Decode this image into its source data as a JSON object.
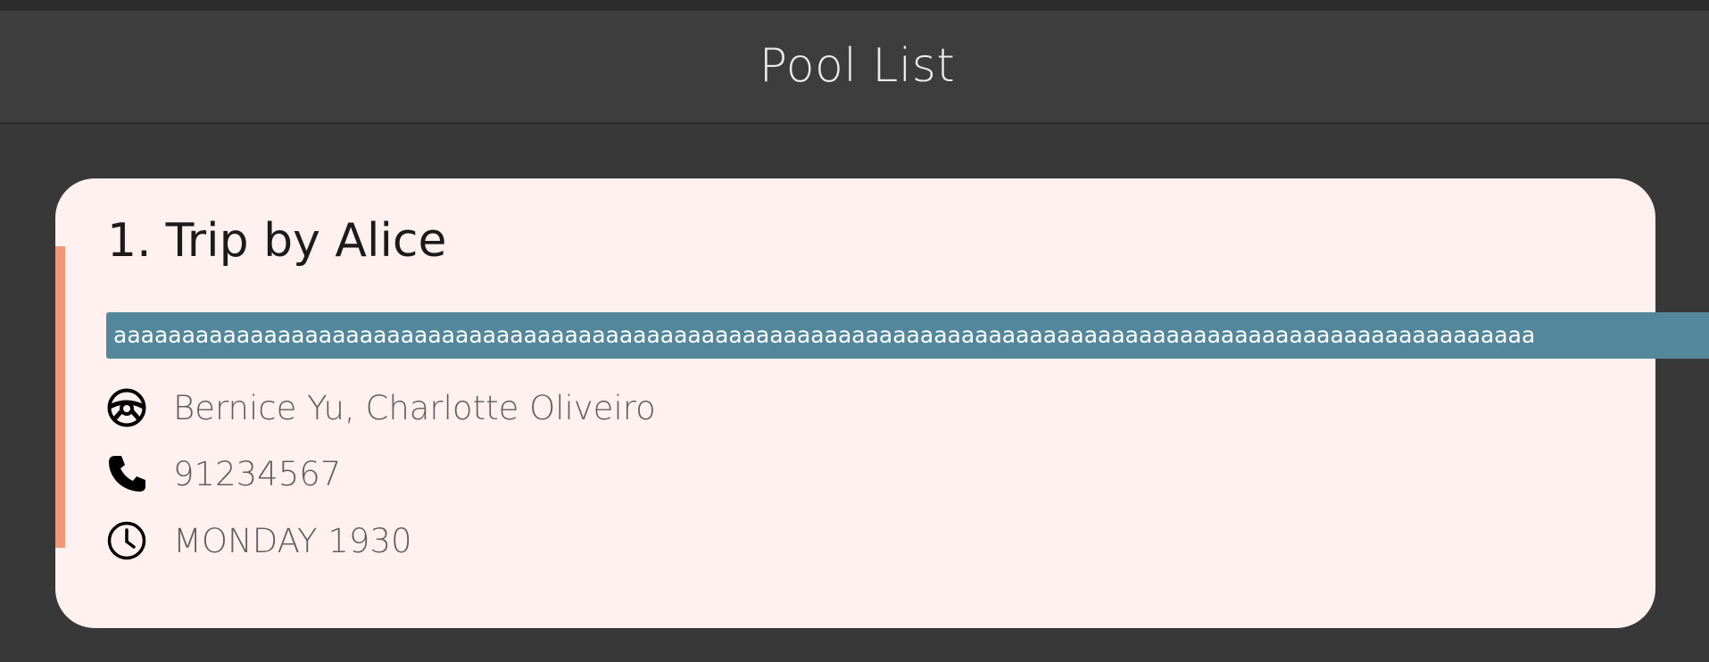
{
  "header": {
    "title": "Pool List"
  },
  "pool_list": {
    "items": [
      {
        "index": "1.",
        "title": "Trip by Alice",
        "tag": "aaaaaaaaaaaaaaaaaaaaaaaaaaaaaaaaaaaaaaaaaaaaaaaaaaaaaaaaaaaaaaaaaaaaaaaaaaaaaaaaaaaaaaaaaaaaaaaaaaaaaaaa",
        "drivers": "Bernice Yu, Charlotte Oliveiro",
        "phone": "91234567",
        "time": "MONDAY 1930",
        "icons": {
          "drivers": "steering-wheel-icon",
          "phone": "phone-icon",
          "time": "clock-icon"
        }
      }
    ]
  },
  "colors": {
    "background": "#383838",
    "header_background": "#3d3d3d",
    "card_background": "#fff1ef",
    "accent": "#f0987a",
    "tag_background": "#52879c"
  }
}
